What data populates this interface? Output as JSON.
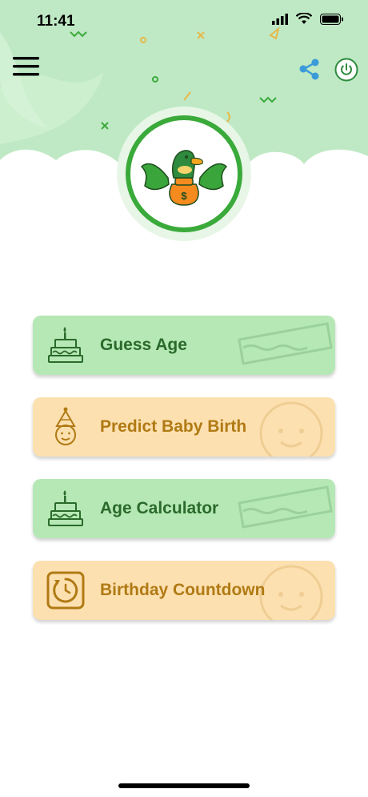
{
  "status_bar": {
    "time": "11:41"
  },
  "header": {
    "menu_icon": "hamburger-menu-icon",
    "share_icon": "share-icon",
    "power_icon": "power-icon",
    "logo_icon": "duck-money-bag-logo",
    "colors": {
      "header_bg": "#bfe9c4",
      "logo_ring": "#3aaa3a"
    }
  },
  "menu": {
    "items": [
      {
        "label": "Guess Age",
        "icon": "birthday-cake-icon",
        "style": "green"
      },
      {
        "label": "Predict Baby Birth",
        "icon": "baby-party-hat-icon",
        "style": "orange"
      },
      {
        "label": "Age Calculator",
        "icon": "birthday-cake-icon",
        "style": "green"
      },
      {
        "label": "Birthday Countdown",
        "icon": "countdown-timer-icon",
        "style": "orange"
      }
    ]
  },
  "colors": {
    "green_card": "#b5e8b5",
    "green_text": "#2b6a2b",
    "orange_card": "#fde0b0",
    "orange_text": "#b07a14"
  }
}
